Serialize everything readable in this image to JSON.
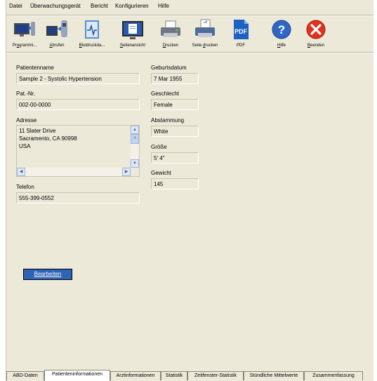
{
  "menu": [
    "Datei",
    "Überwachungsgerät",
    "Bericht",
    "Konfigurieren",
    "Hilfe"
  ],
  "toolbar": [
    {
      "pre": "Pr",
      "u": "o",
      "post": "grammi...",
      "icon": "programm-monitor-icon"
    },
    {
      "pre": "",
      "u": "A",
      "post": "brufen",
      "icon": "download-device-icon"
    },
    {
      "pre": "",
      "u": "B",
      "post": "lutdruckda...",
      "icon": "bp-data-icon"
    },
    {
      "pre": "",
      "u": "S",
      "post": "eitenansicht",
      "icon": "page-view-icon"
    },
    {
      "pre": "",
      "u": "D",
      "post": "rucken",
      "icon": "printer-icon"
    },
    {
      "pre": "Seite ",
      "u": "d",
      "post": "rucken",
      "icon": "print-page-icon"
    },
    {
      "pre": "",
      "u": "",
      "post": "PDF",
      "icon": "pdf-icon"
    },
    {
      "pre": "",
      "u": "H",
      "post": "ilfe",
      "icon": "help-icon"
    },
    {
      "pre": "",
      "u": "B",
      "post": "eenden",
      "icon": "exit-icon"
    }
  ],
  "patient": {
    "name_label": "Patientenname",
    "name": "Sample 2 - Systolic Hypertension",
    "id_label": "Pat.-Nr.",
    "id": "002-00-0000",
    "address_label": "Adresse",
    "address_line1": "11 Slater Drive",
    "address_line2": "Sacramento, CA 90998",
    "address_line3": "USA",
    "phone_label": "Telefon",
    "phone": "555-399-0552",
    "dob_label": "Geburtsdatum",
    "dob": "7 Mar 1955",
    "sex_label": "Geschlecht",
    "sex": "Female",
    "race_label": "Abstammung",
    "race": "White",
    "height_label": "Größe",
    "height": "5' 4\"",
    "weight_label": "Gewicht",
    "weight": "145"
  },
  "edit_button": "Bearbeiten",
  "tabs": [
    "ABD-Daten",
    "Patienteninformationen",
    "Arztinformationen",
    "Statistik",
    "Zeitfenster-Statistik",
    "Stündliche Mittelwerte",
    "Zusammenfassung"
  ],
  "active_tab": "Patienteninformationen",
  "colors": {
    "button_bg": "#2f63b7",
    "exit_red": "#e0301e",
    "help_blue": "#2f66c8",
    "pdf_blue": "#1d62c2"
  }
}
